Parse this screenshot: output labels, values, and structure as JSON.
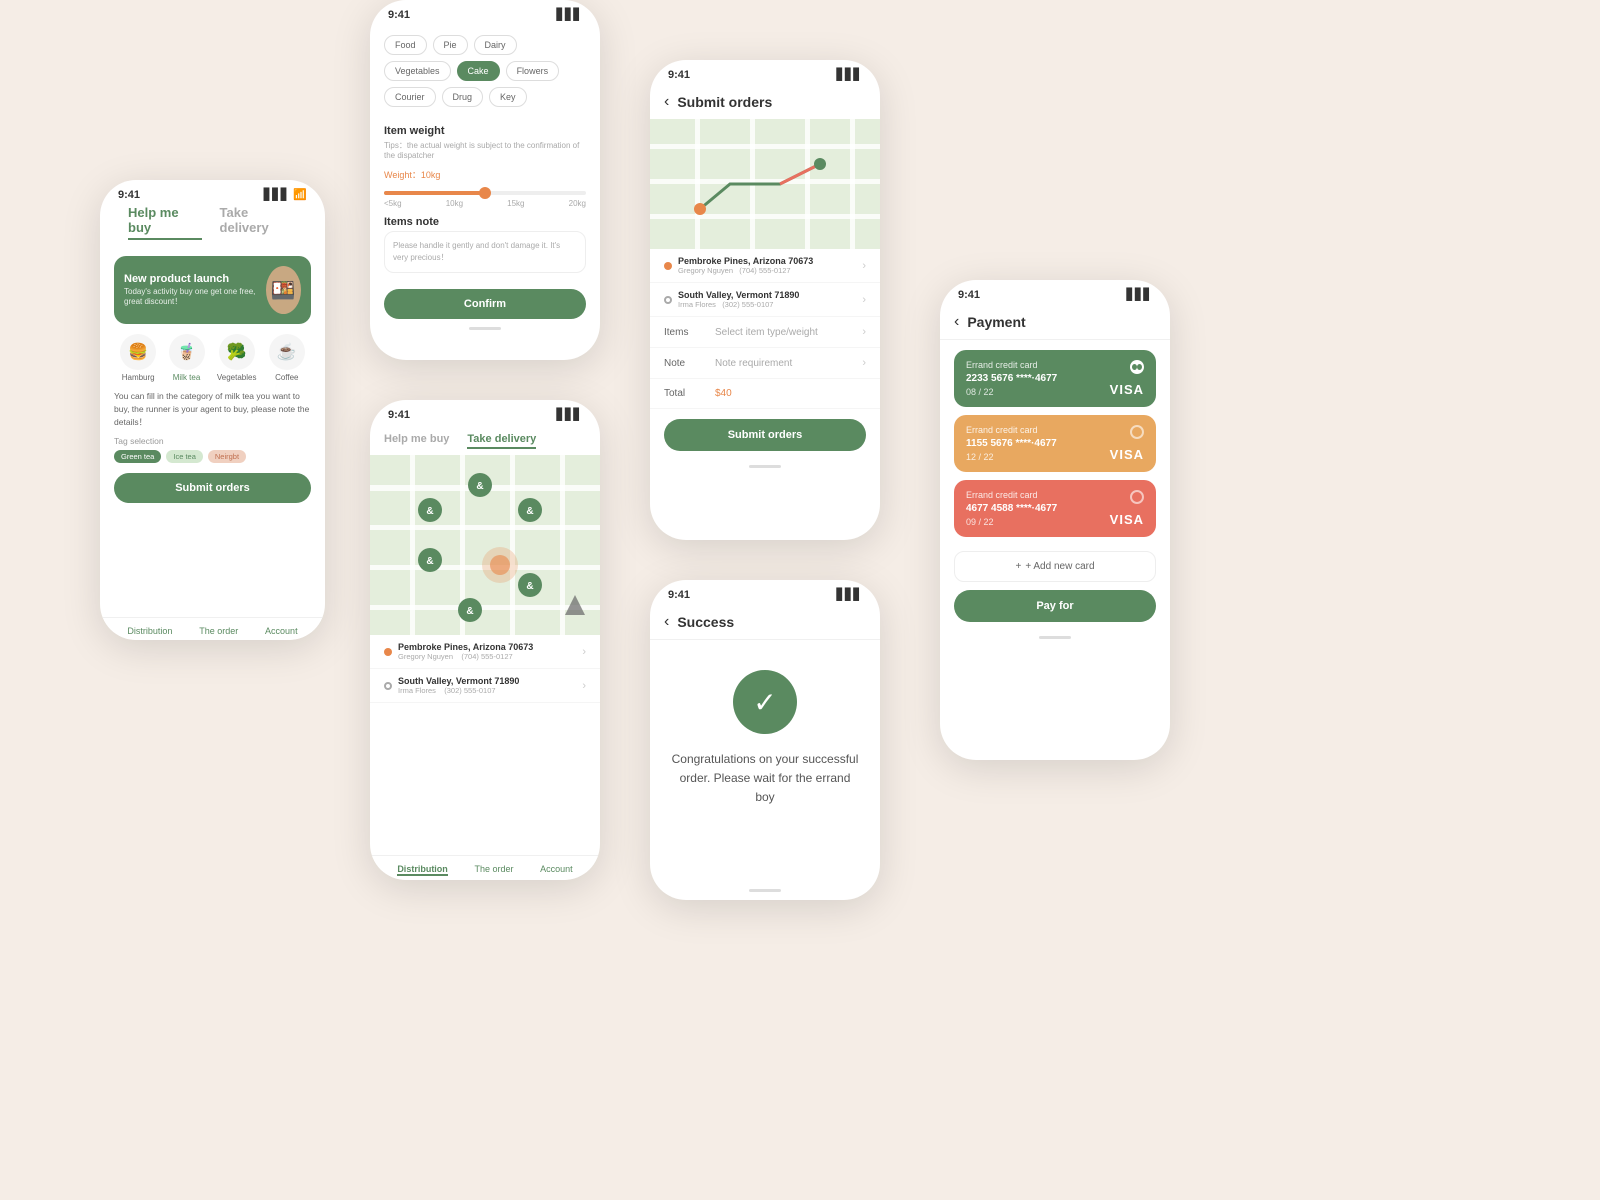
{
  "phone1": {
    "status_time": "9:41",
    "tab_help": "Help me buy",
    "tab_delivery": "Take delivery",
    "banner_title": "New product launch",
    "banner_sub": "Today's activity buy one get one free, great discount！",
    "icons": [
      {
        "id": "hamburg",
        "emoji": "🍔",
        "label": "Hamburg"
      },
      {
        "id": "milktea",
        "emoji": "🧋",
        "label": "Milk tea",
        "active": true
      },
      {
        "id": "vegetables",
        "emoji": "🥦",
        "label": "Vegetables"
      },
      {
        "id": "coffee",
        "emoji": "☕",
        "label": "Coffee"
      }
    ],
    "desc": "You can fill in the category of milk tea you want to buy, the runner is your agent to buy, please note the details！",
    "tag_label": "Tag selection",
    "tags": [
      "Green tea",
      "Ice tea",
      "Neirgbt"
    ],
    "submit_btn": "Submit orders",
    "nav": [
      "Distribution",
      "The order",
      "Account"
    ]
  },
  "phone2": {
    "status_time": "9:41",
    "categories": [
      "Food",
      "Pie",
      "Dairy",
      "Vegetables",
      "Cake",
      "Flowers",
      "Courier",
      "Drug",
      "Key"
    ],
    "active_cat": "Cake",
    "weight_section": "Item weight",
    "weight_tip": "Tips：the actual weight is subject to the confirmation of the dispatcher",
    "weight_value": "Weight：10kg",
    "slider_labels": [
      "<5kg",
      "10kg",
      "15kg",
      "20kg"
    ],
    "note_section": "Items note",
    "note_placeholder": "Please handle it gently and don't damage it. It's very precious！",
    "confirm_btn": "Confirm"
  },
  "phone3": {
    "status_time": "9:41",
    "tab_help": "Help me buy",
    "tab_delivery": "Take delivery",
    "markers": [
      "&o",
      "&o",
      "&o",
      "&o",
      "&o",
      "&o"
    ],
    "loc1_name": "Pembroke Pines, Arizona 70673",
    "loc1_person": "Gregory Nguyen",
    "loc1_phone": "(704) 555-0127",
    "loc2_name": "South Valley, Vermont 71890",
    "loc2_person": "Irma Flores",
    "loc2_phone": "(302) 555-0107",
    "nav": [
      "Distribution",
      "The order",
      "Account"
    ]
  },
  "phone4": {
    "status_time": "9:41",
    "back": "‹",
    "title": "Submit orders",
    "loc1_name": "Pembroke Pines, Arizona 70673",
    "loc1_person": "Gregory Nguyen",
    "loc1_phone": "(704) 555-0127",
    "loc2_name": "South Valley, Vermont 71890",
    "loc2_person": "Irma Flores",
    "loc2_phone": "(302) 555-0107",
    "items_label": "Items",
    "items_value": "Select item type/weight",
    "note_label": "Note",
    "note_value": "Note requirement",
    "total_label": "Total",
    "total_value": "$40",
    "submit_btn": "Submit orders"
  },
  "phone5": {
    "status_time": "9:41",
    "back": "‹",
    "title": "Success",
    "check_icon": "✓",
    "congrats": "Congratulations on your successful order. Please wait for the errand boy"
  },
  "phone6": {
    "status_time": "9:41",
    "back": "‹",
    "title": "Payment",
    "cards": [
      {
        "label": "Errand credit card",
        "number": "2233 5676 ****·4677",
        "expiry": "08 / 22",
        "visa": "VISA",
        "color": "green",
        "radio_state": "checked"
      },
      {
        "label": "Errand credit card",
        "number": "1155 5676 ****·4677",
        "expiry": "12 / 22",
        "visa": "VISA",
        "color": "orange",
        "radio_state": "unchecked"
      },
      {
        "label": "Errand credit card",
        "number": "4677 4588 ****·4677",
        "expiry": "09 / 22",
        "visa": "VISA",
        "color": "red",
        "radio_state": "unchecked"
      }
    ],
    "add_card_label": "+ Add new card",
    "pay_btn": "Pay for"
  }
}
